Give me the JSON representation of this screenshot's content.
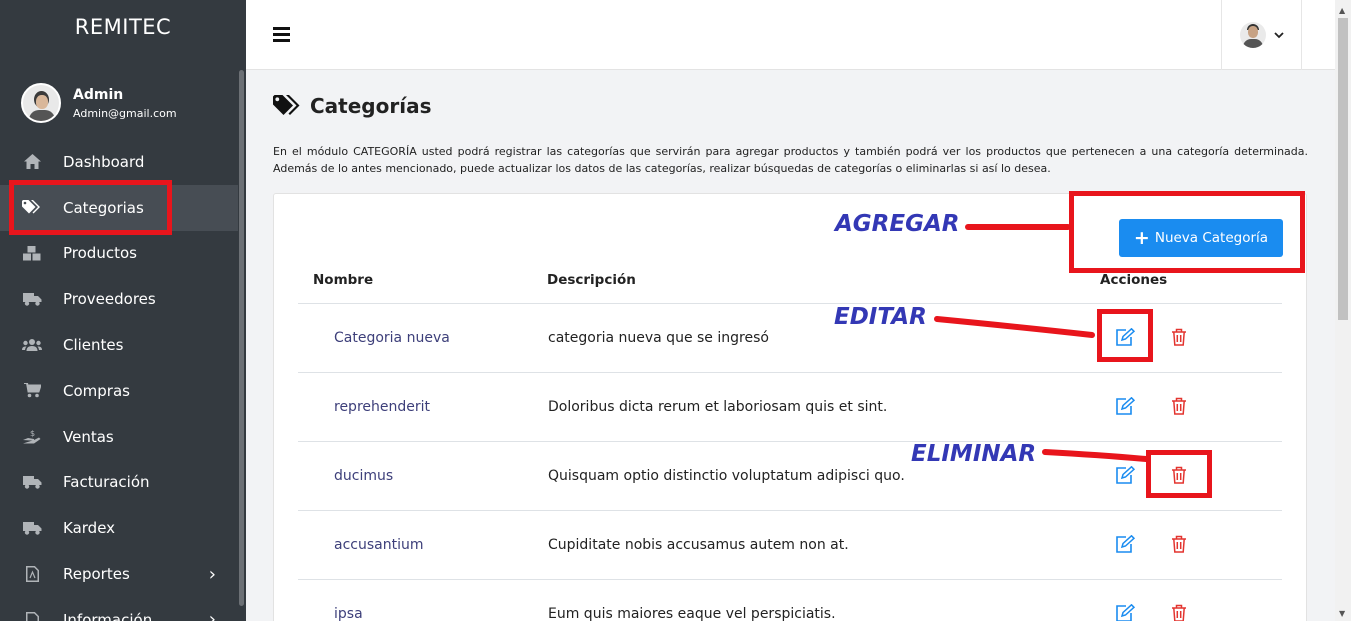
{
  "app": {
    "brand": "REMITEC"
  },
  "user": {
    "name": "Admin",
    "email": "Admin@gmail.com"
  },
  "sidebar": {
    "items": [
      {
        "label": "Dashboard",
        "icon": "home-icon",
        "active": false
      },
      {
        "label": "Categorias",
        "icon": "tags-icon",
        "active": true
      },
      {
        "label": "Productos",
        "icon": "boxes-icon",
        "active": false
      },
      {
        "label": "Proveedores",
        "icon": "truck-icon",
        "active": false
      },
      {
        "label": "Clientes",
        "icon": "users-icon",
        "active": false
      },
      {
        "label": "Compras",
        "icon": "cart-icon",
        "active": false
      },
      {
        "label": "Ventas",
        "icon": "hand-money-icon",
        "active": false
      },
      {
        "label": "Facturación",
        "icon": "truck-icon",
        "active": false
      },
      {
        "label": "Kardex",
        "icon": "truck-icon",
        "active": false
      },
      {
        "label": "Reportes",
        "icon": "file-pdf-icon",
        "active": false,
        "expandable": true
      },
      {
        "label": "Información",
        "icon": "file-icon",
        "active": false,
        "expandable": true
      }
    ]
  },
  "page": {
    "title": "Categorías",
    "description": "En el módulo CATEGORÍA usted podrá registrar las categorías que servirán para agregar productos y también podrá ver los productos que pertenecen a una categoría determinada. Además de lo antes mencionado, puede actualizar los datos de las categorías, realizar búsquedas de categorías o eliminarlas si así lo desea."
  },
  "toolbar": {
    "new_label": "Nueva Categoría"
  },
  "table": {
    "headers": {
      "name": "Nombre",
      "description": "Descripción",
      "actions": "Acciones"
    },
    "rows": [
      {
        "name": "Categoria nueva",
        "description": "categoria nueva que se ingresó"
      },
      {
        "name": "reprehenderit",
        "description": "Doloribus dicta rerum et laboriosam quis et sint."
      },
      {
        "name": "ducimus",
        "description": "Quisquam optio distinctio voluptatum adipisci quo."
      },
      {
        "name": "accusantium",
        "description": "Cupiditate nobis accusamus autem non at."
      },
      {
        "name": "ipsa",
        "description": "Eum quis maiores eaque vel perspiciatis."
      }
    ]
  },
  "annotations": {
    "add": "AGREGAR",
    "edit": "EDITAR",
    "delete": "ELIMINAR"
  },
  "colors": {
    "sidebar": "#343a40",
    "primary": "#1a8cf0",
    "danger": "#e3342f",
    "annotation_red": "#e8151c",
    "annotation_text": "#3338b5"
  }
}
